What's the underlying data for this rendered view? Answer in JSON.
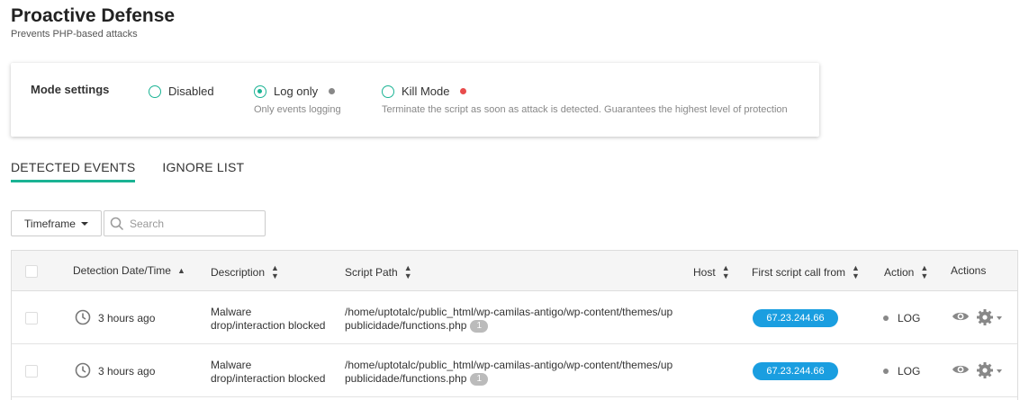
{
  "header": {
    "title": "Proactive Defense",
    "subtitle": "Prevents PHP-based attacks"
  },
  "mode_settings": {
    "label": "Mode settings",
    "options": [
      {
        "label": "Disabled",
        "description": "",
        "checked": false,
        "indicator_color": ""
      },
      {
        "label": "Log only",
        "description": "Only events logging",
        "checked": true,
        "indicator_color": "#888888"
      },
      {
        "label": "Kill Mode",
        "description": "Terminate the script as soon as attack is detected. Guarantees the highest level of protection",
        "checked": false,
        "indicator_color": "#e84c4c"
      }
    ]
  },
  "tabs": [
    {
      "label": "DETECTED EVENTS",
      "active": true
    },
    {
      "label": "IGNORE LIST",
      "active": false
    }
  ],
  "toolbar": {
    "timeframe_label": "Timeframe",
    "search_placeholder": "Search"
  },
  "table": {
    "columns": [
      "Detection Date/Time",
      "Description",
      "Script Path",
      "Host",
      "First script call from",
      "Action",
      "Actions"
    ],
    "rows": [
      {
        "time": "3 hours ago",
        "description": "Malware drop/interaction blocked",
        "script_path": "/home/uptotalc/public_html/wp-camilas-antigo/wp-content/themes/uppublicidade/functions.php",
        "count": "1",
        "host": "",
        "first_call_from": "67.23.244.66",
        "action": "LOG"
      },
      {
        "time": "3 hours ago",
        "description": "Malware drop/interaction blocked",
        "script_path": "/home/uptotalc/public_html/wp-camilas-antigo/wp-content/themes/uppublicidade/functions.php",
        "count": "1",
        "host": "",
        "first_call_from": "67.23.244.66",
        "action": "LOG"
      }
    ]
  },
  "colors": {
    "accent": "#1ab394",
    "ip_badge": "#1a9ee0"
  }
}
